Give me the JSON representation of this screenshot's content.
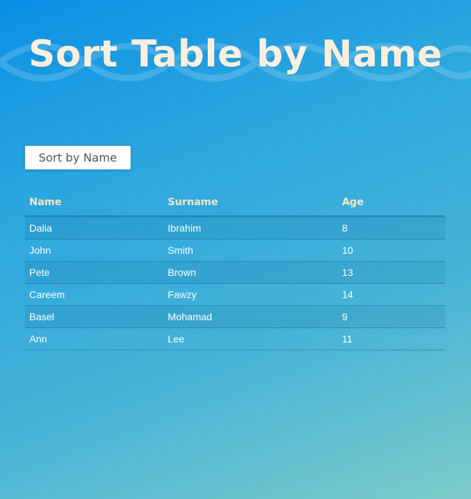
{
  "page": {
    "title": "Sort Table by Name"
  },
  "controls": {
    "sort_button_label": "Sort by Name"
  },
  "table": {
    "headers": {
      "name": "Name",
      "surname": "Surname",
      "age": "Age"
    },
    "rows": [
      {
        "name": "Dalia",
        "surname": "Ibrahim",
        "age": "8"
      },
      {
        "name": "John",
        "surname": "Smith",
        "age": "10"
      },
      {
        "name": "Pete",
        "surname": "Brown",
        "age": "13"
      },
      {
        "name": "Careem",
        "surname": "Fawzy",
        "age": "14"
      },
      {
        "name": "Basel",
        "surname": "Mohamad",
        "age": "9"
      },
      {
        "name": "Ann",
        "surname": "Lee",
        "age": "11"
      }
    ]
  },
  "colors": {
    "title": "#fbf0df",
    "header_text": "#f6e6c8",
    "cell_text": "#ffffff",
    "button_bg": "#ffffff",
    "button_text": "#555555",
    "background_top": "#0b8fe6",
    "background_bottom": "#7ccbc8"
  }
}
